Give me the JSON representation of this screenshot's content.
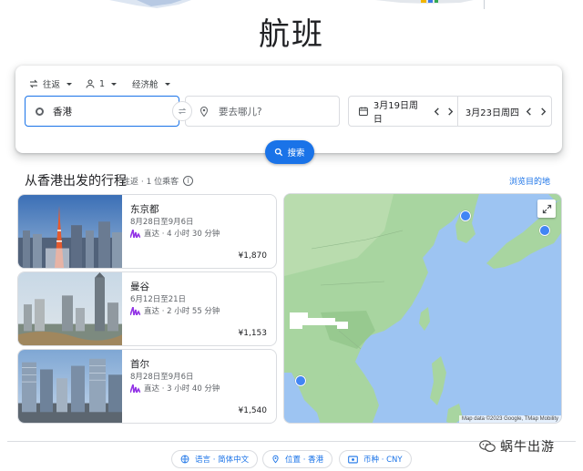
{
  "page": {
    "title": "航班"
  },
  "search": {
    "trip_type": "往返",
    "passengers": "1",
    "cabin_class": "经济舱",
    "origin": "香港",
    "destination_placeholder": "要去哪儿?",
    "depart_date": "3月19日周日",
    "return_date": "3月23日周四",
    "search_label": "搜索"
  },
  "section": {
    "title": "从香港出发的行程",
    "meta": "往返 · 1 位乘客",
    "explore_link": "浏览目的地"
  },
  "destinations": [
    {
      "name": "东京都",
      "dates": "8月28日至9月6日",
      "flight": "直达 · 4 小时 30 分钟",
      "price": "¥1,870"
    },
    {
      "name": "曼谷",
      "dates": "6月12日至21日",
      "flight": "直达 · 2 小时 55 分钟",
      "price": "¥1,153"
    },
    {
      "name": "首尔",
      "dates": "8月28日至9月6日",
      "flight": "直达 · 3 小时 40 分钟",
      "price": "¥1,540"
    }
  ],
  "map": {
    "credit": "Map data ©2023 Google, TMap Mobility"
  },
  "footer": {
    "language": "语言 · 简体中文",
    "location": "位置 · 香港",
    "currency": "币种 · CNY"
  },
  "watermark": "蜗牛出游",
  "colors": {
    "accent": "#1a73e8",
    "airline": "#9334e6",
    "map_water": "#9dc4f2",
    "map_land": "#a8d5a0"
  }
}
